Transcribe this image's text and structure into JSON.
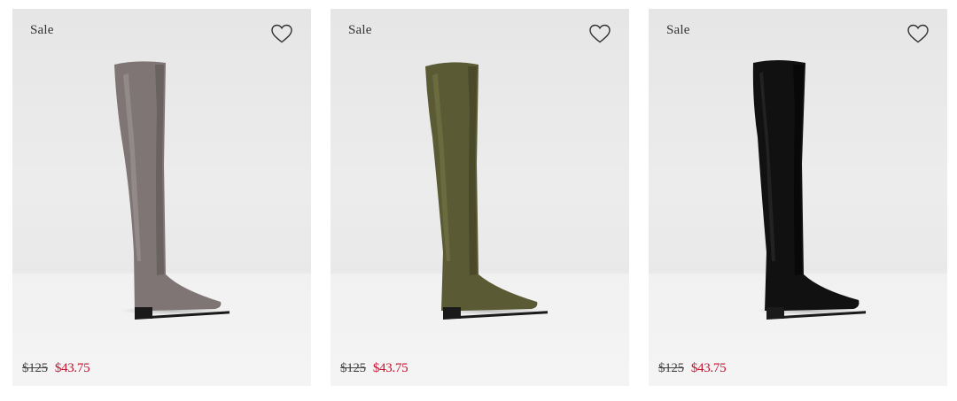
{
  "products": [
    {
      "badge": "Sale",
      "price_old": "$125",
      "price_new": "$43.75",
      "color": "#7e7574",
      "shade": "#6a6261",
      "highlight": "#928a89"
    },
    {
      "badge": "Sale",
      "price_old": "$125",
      "price_new": "$43.75",
      "color": "#5a5a34",
      "shade": "#4a4a2a",
      "highlight": "#6b6b40"
    },
    {
      "badge": "Sale",
      "price_old": "$125",
      "price_new": "$43.75",
      "color": "#111111",
      "shade": "#080808",
      "highlight": "#222222"
    }
  ],
  "icons": {
    "favorite": "heart-outline-icon"
  }
}
